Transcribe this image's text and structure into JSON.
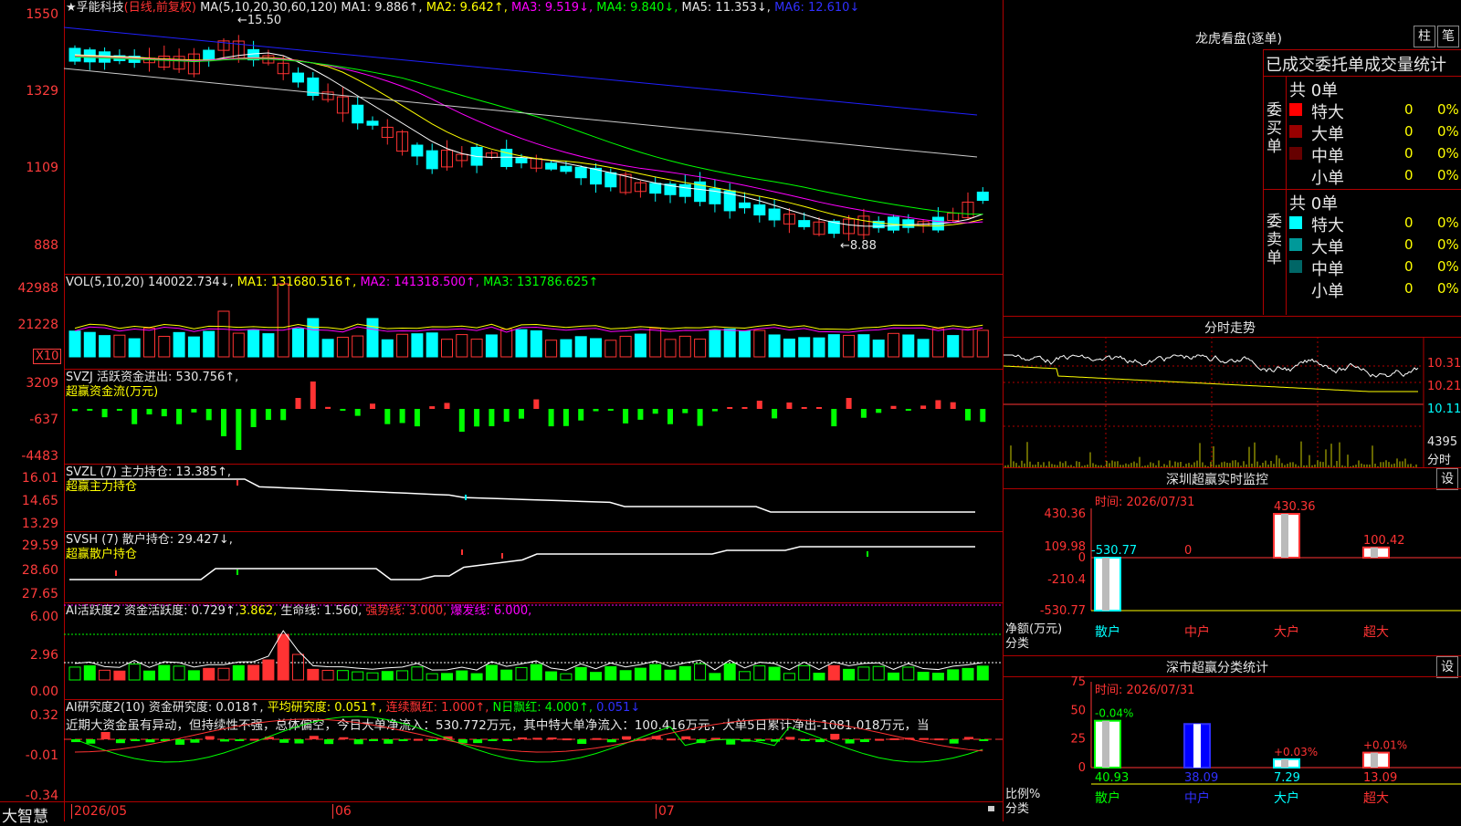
{
  "colors": {
    "up": "#ff3333",
    "down": "#00ffff",
    "grid": "#b00000"
  },
  "main": {
    "star": "★",
    "name": "孚能科技",
    "period": "(日线,前复权)",
    "ma_label": "MA(5,10,20,30,60,120)",
    "ma1": "MA1: 9.886↑,",
    "ma2": "MA2: 9.642↑,",
    "ma3": "MA3: 9.519↓,",
    "ma4": "MA4: 9.840↓,",
    "ma5": "MA5: 11.353↓,",
    "ma6": "MA6: 12.610↓",
    "yticks": [
      "1550",
      "1329",
      "1109",
      "888"
    ],
    "high_note": "15.50",
    "low_note": "8.88"
  },
  "vol": {
    "label": "VOL(5,10,20)",
    "val": "140022.734↓,",
    "ma1": "MA1: 131680.516↑,",
    "ma2": "MA2: 141318.500↑,",
    "ma3": "MA3: 131786.625↑",
    "yticks": [
      "42988",
      "21228"
    ],
    "unit": "X10"
  },
  "svzj": {
    "label": "SVZJ  活跃资金进出: 530.756↑,",
    "sub": "超赢资金流(万元)",
    "yticks": [
      "3209",
      "-637",
      "-4483"
    ]
  },
  "svzl": {
    "label": "SVZL (7) 主力持仓: 13.385↑,",
    "sub": "超赢主力持仓",
    "yticks": [
      "16.01",
      "14.65",
      "13.29"
    ]
  },
  "svsh": {
    "label": "SVSH (7) 散户持仓: 29.427↓,",
    "sub": "超赢散户持仓",
    "yticks": [
      "29.59",
      "28.60",
      "27.65"
    ]
  },
  "ai1": {
    "p1": "AI活跃度2 资金活跃度: 0.729↑,",
    "p2": "3.862,",
    "p3": " 生命线: 1.560,",
    "p4": " 强势线: 3.000,",
    "p5": " 爆发线: 6.000,",
    "yticks": [
      "6.00",
      "2.96",
      "0.00"
    ]
  },
  "ai2": {
    "p1": "AI研究度2(10) 资金研究度: 0.018↑,",
    "p2": " 平均研究度: 0.051↑,",
    "p3": " 连续飘红: 1.000↑,",
    "p4": " N日飘红: 4.000↑,",
    "p5": " 0.051↓",
    "comment": "近期大资金虽有异动，但持续性不强，总体偏空，今日大单净流入：530.772万元，其中特大单净流入：100.416万元，大单5日累计净出-1081.018万元，当",
    "yticks": [
      "0.32",
      "-0.01",
      "-0.34"
    ]
  },
  "footer": {
    "logo": "大智慧",
    "dates": [
      "2026/05",
      "06",
      "07"
    ]
  },
  "lhb": {
    "title": "龙虎看盘(逐单)",
    "btn1": "柱",
    "btn2": "笔",
    "header": "已成交委托单成交量统计",
    "buy": {
      "side": "委买单",
      "total": "共 0单",
      "rows": [
        {
          "name": "特大",
          "v": "0",
          "p": "0%"
        },
        {
          "name": "大单",
          "v": "0",
          "p": "0%"
        },
        {
          "name": "中单",
          "v": "0",
          "p": "0%"
        },
        {
          "name": "小单",
          "v": "0",
          "p": "0%"
        }
      ]
    },
    "sell": {
      "side": "委卖单",
      "total": "共 0单",
      "rows": [
        {
          "name": "特大",
          "v": "0",
          "p": "0%"
        },
        {
          "name": "大单",
          "v": "0",
          "p": "0%"
        },
        {
          "name": "中单",
          "v": "0",
          "p": "0%"
        },
        {
          "name": "小单",
          "v": "0",
          "p": "0%"
        }
      ]
    }
  },
  "fs": {
    "title": "分时走势",
    "yticks": [
      "10.31",
      "10.21",
      "10.11"
    ],
    "vol": "4395",
    "vunit": "分时"
  },
  "szjk": {
    "title": "深圳超赢实时监控",
    "btn": "设",
    "time": "时间: 2026/07/31",
    "yticks": [
      "430.36",
      "109.98",
      "0",
      "-210.4",
      "-530.77"
    ],
    "unit1": "净额(万元)",
    "unit2": "分类",
    "cats": [
      "散户",
      "中户",
      "大户",
      "超大"
    ],
    "values": [
      -530.77,
      0,
      430.36,
      100.42
    ],
    "labels": [
      "-530.77",
      "0",
      "430.36",
      "100.42"
    ]
  },
  "flt": {
    "title": "深市超赢分类统计",
    "btn": "设",
    "time": "时间: 2026/07/31",
    "yticks": [
      "75",
      "50",
      "25",
      "0"
    ],
    "unit1": "比例%",
    "unit2": "分类",
    "cats": [
      "散户",
      "中户",
      "大户",
      "超大"
    ],
    "values": [
      40.93,
      38.09,
      7.29,
      13.09
    ],
    "changes": [
      "-0.04%",
      "",
      "+0.03%",
      "+0.01%"
    ]
  }
}
